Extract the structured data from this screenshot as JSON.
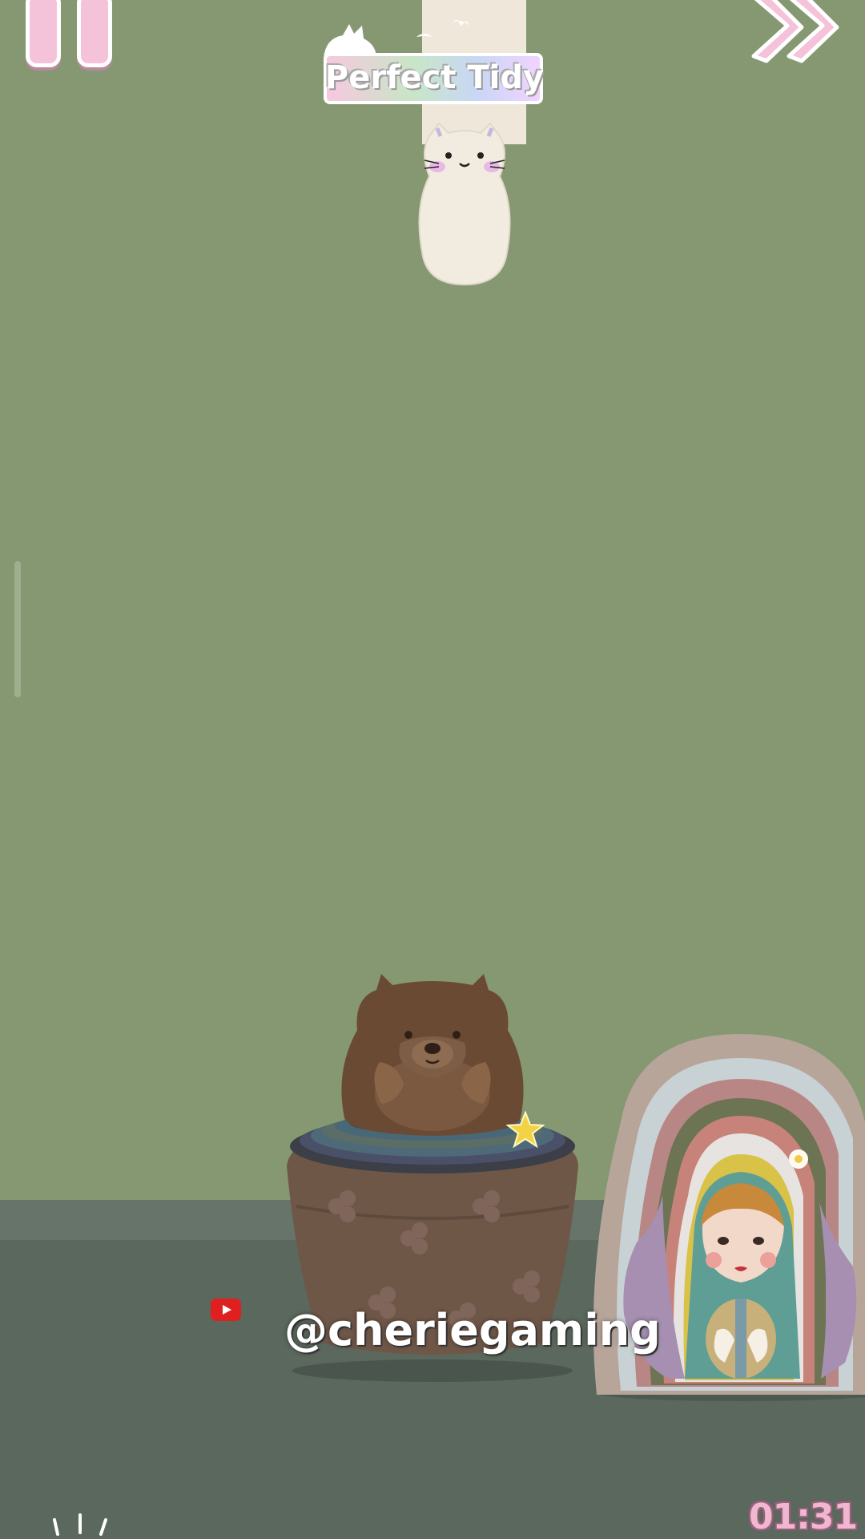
{
  "hud": {
    "pause_icon": "pause-icon",
    "skip_icon": "fast-forward-icon",
    "timer": "01:31"
  },
  "level_banner": {
    "title": "Perfect Tidy",
    "icon": "cat-silhouette-icon"
  },
  "colors": {
    "background": "#869872",
    "floor": "#5b685d",
    "accent_pink": "#f5c3d9",
    "youtube_red": "#e02020"
  },
  "watermark": {
    "icon": "youtube-icon",
    "handle": "@cheriegaming"
  },
  "scene": {
    "falling_piece": "cat-doll",
    "center_piece": "bear-nesting-doll",
    "right_piece": "matryoshka-doll-stack",
    "star_icon": "star-icon"
  }
}
